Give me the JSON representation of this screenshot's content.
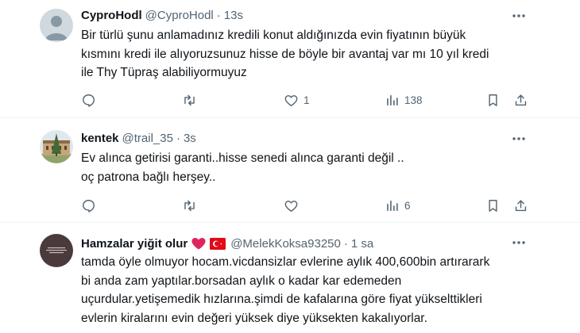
{
  "tweets": [
    {
      "name": "CyproHodl",
      "handle": "@CyproHodl",
      "dot": "·",
      "time": "13s",
      "lines": [
        "Bir türlü şunu anlamadınız kredili konut aldığınızda evin fiyatının büyük",
        "kısmını kredi ile alıyoruzsunuz hisse de böyle bir avantaj var mı 10 yıl kredi",
        "ile Thy Tüpraş alabiliyormuyuz"
      ],
      "counts": {
        "reply": "",
        "retweet": "",
        "like": "1",
        "views": "138"
      }
    },
    {
      "name": "kentek",
      "handle": "@trail_35",
      "dot": "·",
      "time": "3s",
      "lines": [
        "Ev alınca getirisi garanti..hisse senedi alınca garanti değil ..",
        "oç patrona bağlı herşey.."
      ],
      "counts": {
        "reply": "",
        "retweet": "",
        "like": "",
        "views": "6"
      }
    },
    {
      "name": "Hamzalar yiğit olur",
      "handle": "@MelekKoksa93250",
      "dot": "·",
      "time": "1 sa",
      "lines": [
        "tamda öyle olmuyor hocam.vicdansizlar evlerine aylık 400,600bin artırarark",
        "bi anda zam yaptılar.borsadan aylık o kadar kar edemeden",
        "uçurdular.yetişemedik hızlarına.şimdi de kafalarına göre fiyat yükselttikleri",
        "evlerin kiralarını evin değeri yüksek diye yüksekten kakalıyorlar."
      ],
      "emoji": [
        "red-heart",
        "turkey-flag"
      ]
    }
  ],
  "colors": {
    "text": "#0f1419",
    "muted": "#536471",
    "divider": "#eff3f4",
    "heart": "#e0245e",
    "flag": "#e30a17"
  }
}
